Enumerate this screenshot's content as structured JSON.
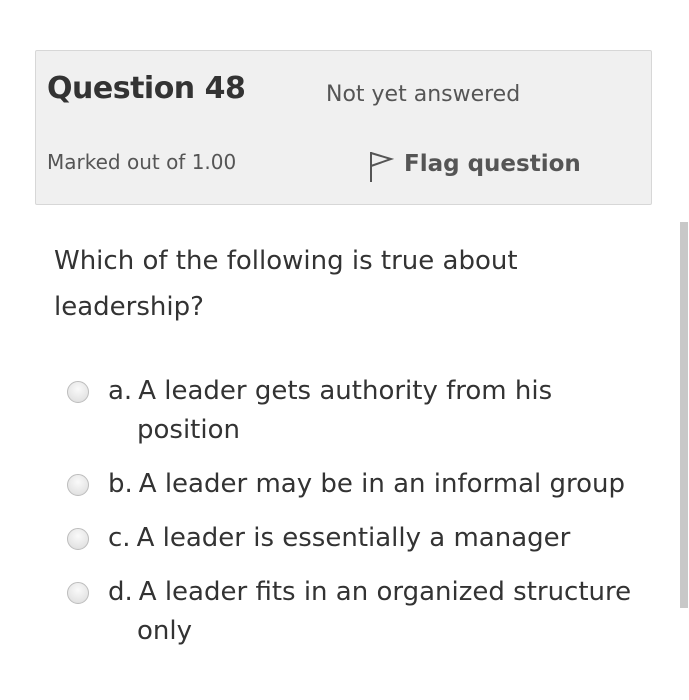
{
  "question_info": {
    "number_label": "Question 48",
    "state": "Not yet answered",
    "grade": "Marked out of 1.00",
    "flag_label": "Flag question"
  },
  "question": {
    "text": "Which of the following is true about leadership?"
  },
  "answers": [
    {
      "letter": "a.",
      "text": "A leader gets authority from his position",
      "selected": false
    },
    {
      "letter": "b.",
      "text": "A leader may be in an informal group",
      "selected": false
    },
    {
      "letter": "c.",
      "text": "A leader is essentially a manager",
      "selected": false
    },
    {
      "letter": "d.",
      "text": "A leader fits in an organized structure only",
      "selected": false
    }
  ],
  "colors": {
    "info_background": "#f0f0f0",
    "text": "#333333",
    "muted_text": "#555555"
  },
  "icons": {
    "flag": "flag-icon",
    "radio": "radio-icon"
  }
}
